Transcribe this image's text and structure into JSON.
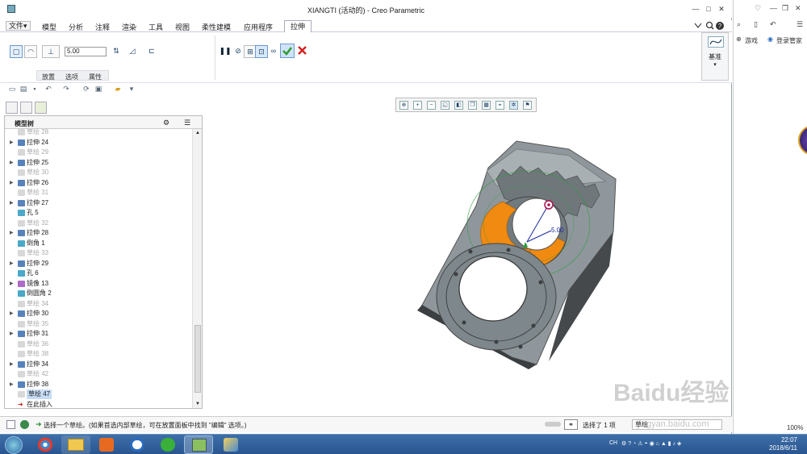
{
  "window": {
    "title": "XIANGTI (活动的) - Creo Parametric",
    "controls": {
      "help": "?",
      "minimize": "—",
      "maximize": "□",
      "close": "✕"
    }
  },
  "menu": {
    "file": "文件▾",
    "items": [
      "模型",
      "分析",
      "注释",
      "渲染",
      "工具",
      "视图",
      "柔性建模",
      "应用程序"
    ],
    "active_tab": "拉伸",
    "question": "?"
  },
  "ribbon": {
    "depth_value": "5.00",
    "subtabs": [
      "放置",
      "选项",
      "属性"
    ],
    "datum_label": "基准",
    "datum_arrow": "▾",
    "ok_color": "#3aa53a",
    "cancel_color": "#d62020"
  },
  "model_tree": {
    "header": "模型树",
    "rows": [
      {
        "label": "草绘 28",
        "type": "sketch",
        "dim": true,
        "arrow": false
      },
      {
        "label": "拉伸 24",
        "type": "extrude",
        "dim": false,
        "arrow": true
      },
      {
        "label": "草绘 29",
        "type": "sketch",
        "dim": true,
        "arrow": false
      },
      {
        "label": "拉伸 25",
        "type": "extrude",
        "dim": false,
        "arrow": true
      },
      {
        "label": "草绘 30",
        "type": "sketch",
        "dim": true,
        "arrow": false
      },
      {
        "label": "拉伸 26",
        "type": "extrude",
        "dim": false,
        "arrow": true
      },
      {
        "label": "草绘 31",
        "type": "sketch",
        "dim": true,
        "arrow": false
      },
      {
        "label": "拉伸 27",
        "type": "extrude",
        "dim": false,
        "arrow": true
      },
      {
        "label": "孔 5",
        "type": "hole",
        "dim": false,
        "arrow": false
      },
      {
        "label": "草绘 32",
        "type": "sketch",
        "dim": true,
        "arrow": false
      },
      {
        "label": "拉伸 28",
        "type": "extrude",
        "dim": false,
        "arrow": true
      },
      {
        "label": "倒角 1",
        "type": "chamfer",
        "dim": false,
        "arrow": false
      },
      {
        "label": "草绘 33",
        "type": "sketch",
        "dim": true,
        "arrow": false
      },
      {
        "label": "拉伸 29",
        "type": "extrude",
        "dim": false,
        "arrow": true
      },
      {
        "label": "孔 6",
        "type": "hole",
        "dim": false,
        "arrow": false
      },
      {
        "label": "镜像 13",
        "type": "mirror",
        "dim": false,
        "arrow": true
      },
      {
        "label": "倒圆角 2",
        "type": "round",
        "dim": false,
        "arrow": false
      },
      {
        "label": "草绘 34",
        "type": "sketch",
        "dim": true,
        "arrow": false
      },
      {
        "label": "拉伸 30",
        "type": "extrude",
        "dim": false,
        "arrow": true
      },
      {
        "label": "草绘 35",
        "type": "sketch",
        "dim": true,
        "arrow": false
      },
      {
        "label": "拉伸 31",
        "type": "extrude",
        "dim": false,
        "arrow": true
      },
      {
        "label": "草绘 36",
        "type": "sketch",
        "dim": true,
        "arrow": false
      },
      {
        "label": "草绘 38",
        "type": "sketch",
        "dim": true,
        "arrow": false
      },
      {
        "label": "拉伸 34",
        "type": "extrude",
        "dim": false,
        "arrow": true
      },
      {
        "label": "草绘 42",
        "type": "sketch",
        "dim": true,
        "arrow": false
      },
      {
        "label": "拉伸 38",
        "type": "extrude",
        "dim": false,
        "arrow": true
      },
      {
        "label": "草绘 47",
        "type": "sketch",
        "dim": false,
        "arrow": false,
        "selected": true
      },
      {
        "label": "在此插入",
        "type": "insert",
        "dim": false,
        "arrow": false
      }
    ]
  },
  "viewport": {
    "dimension_label": "5.00",
    "part_color": "#8f979c",
    "highlight_color": "#f08a10"
  },
  "status": {
    "message": "选择一个草绘。(如果首选内部草绘，可在放置面板中找到 \"编辑\" 选项。)",
    "selection": "选择了 1 项",
    "filter": "草绘"
  },
  "browser": {
    "game_label": "游戏",
    "manager_label": "登录管家",
    "zoom": "100%"
  },
  "taskbar": {
    "time": "22:07",
    "date": "2018/6/11",
    "lang": "CH"
  },
  "watermark": "Baidu经验",
  "watermark_url": "jingyan.baidu.com"
}
